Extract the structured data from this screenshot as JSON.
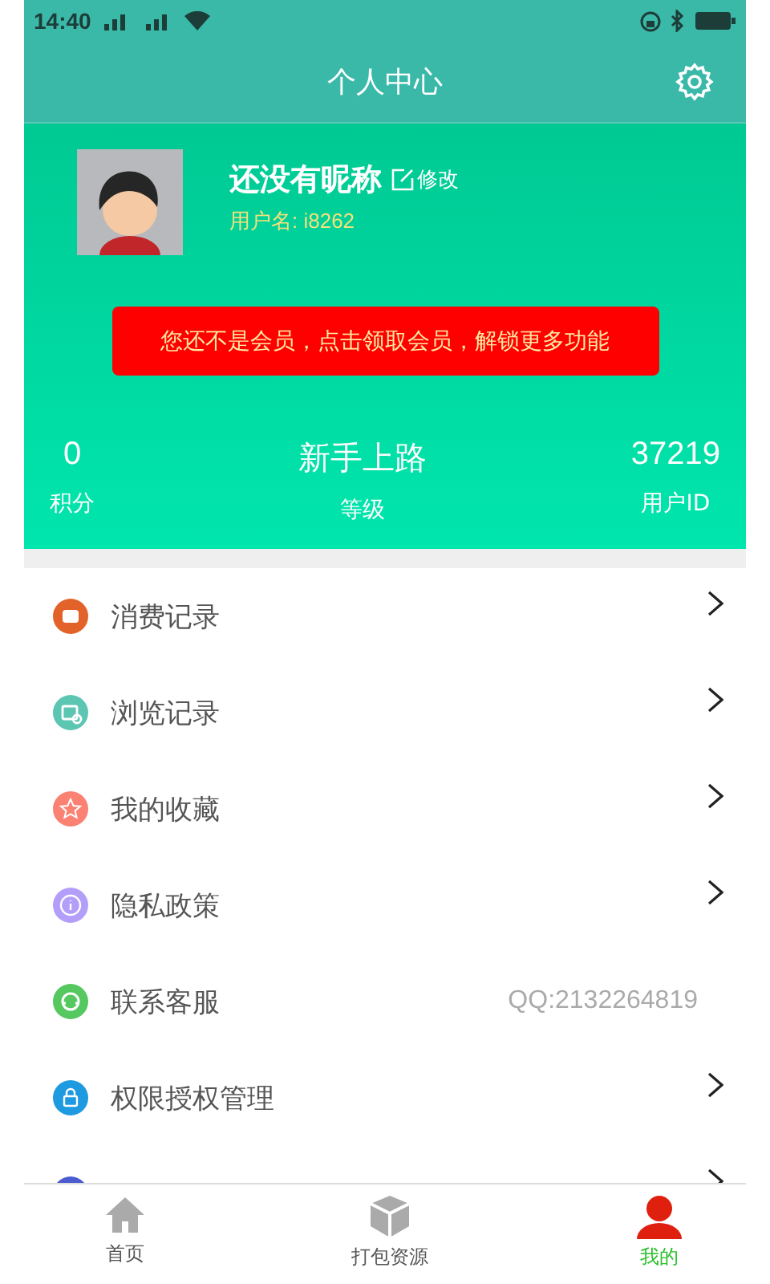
{
  "status_bar": {
    "time": "14:40"
  },
  "header": {
    "title": "个人中心"
  },
  "profile": {
    "nickname": "还没有昵称",
    "edit_label": "修改",
    "username": "用户名: i8262",
    "member_banner": "您还不是会员，点击领取会员，解锁更多功能"
  },
  "stats": [
    {
      "value": "0",
      "label": "积分"
    },
    {
      "value": "新手上路",
      "label": "等级"
    },
    {
      "value": "37219",
      "label": "用户ID"
    }
  ],
  "menu": [
    {
      "kind": "receipt",
      "color": "#e2622a",
      "label": "消费记录",
      "chevron": true
    },
    {
      "kind": "browse",
      "color": "#5cc6b2",
      "label": "浏览记录",
      "chevron": true
    },
    {
      "kind": "star",
      "color": "#fb8173",
      "label": "我的收藏",
      "chevron": true
    },
    {
      "kind": "info",
      "color": "#b39ffa",
      "label": "隐私政策",
      "chevron": true
    },
    {
      "kind": "headset",
      "color": "#55c860",
      "label": "联系客服",
      "detail": "QQ:2132264819",
      "chevron": false
    },
    {
      "kind": "lock",
      "color": "#1e9ae0",
      "label": "权限授权管理",
      "chevron": true
    },
    {
      "kind": "about",
      "color": "#4b5bd0",
      "chevron": true
    }
  ],
  "tab_bar": [
    {
      "kind": "home",
      "label": "首页",
      "selected": false
    },
    {
      "kind": "package",
      "label": "打包资源",
      "selected": false
    },
    {
      "kind": "person",
      "label": "我的",
      "selected": true
    }
  ]
}
